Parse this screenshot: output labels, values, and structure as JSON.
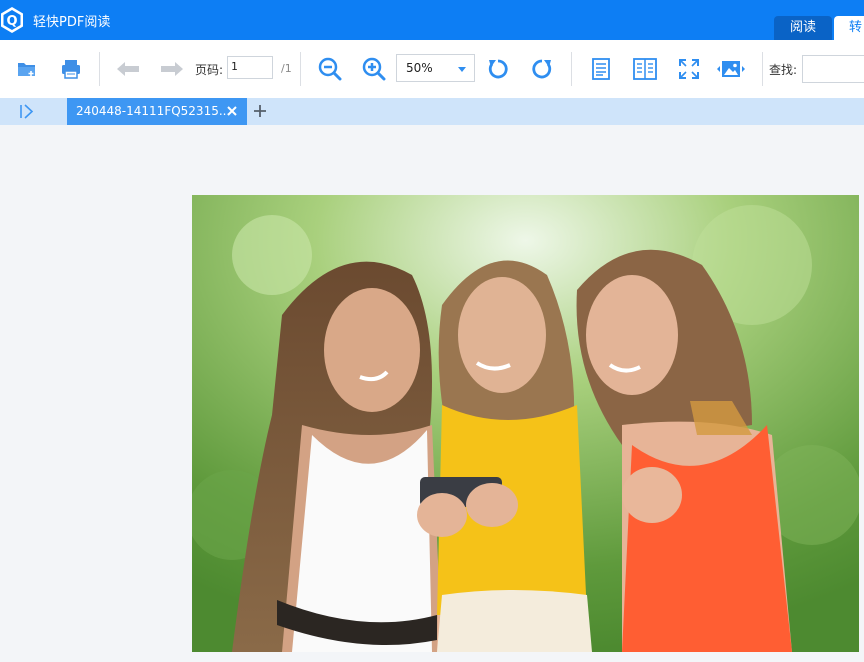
{
  "app": {
    "title": "轻快PDF阅读",
    "logo_letter": "Q"
  },
  "mode_tabs": [
    {
      "label": "阅读",
      "active": true
    },
    {
      "label": "转",
      "active": false
    }
  ],
  "toolbar": {
    "page_label": "页码:",
    "page_value": "1",
    "page_total": "/1",
    "zoom_value": "50%",
    "search_label": "查找:",
    "search_value": ""
  },
  "tabs": [
    {
      "name": "240448-14111FQ52315...",
      "active": true
    }
  ],
  "colors": {
    "titlebar": "#0d7ef4",
    "tabstrip": "#cfe4fa",
    "active_tab": "#3e97f3",
    "icon_blue": "#2f8ef0"
  }
}
